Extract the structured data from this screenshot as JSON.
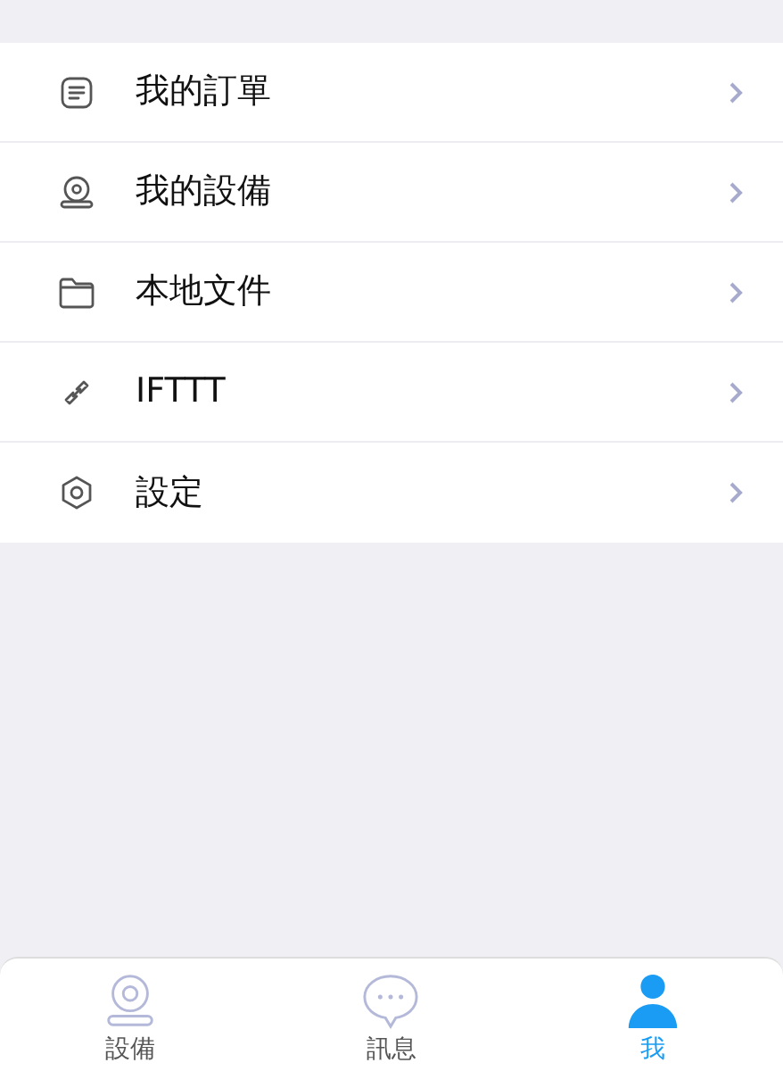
{
  "menu": [
    {
      "kind": "orders",
      "label": "我的訂單"
    },
    {
      "kind": "devices",
      "label": "我的設備"
    },
    {
      "kind": "files",
      "label": "本地文件"
    },
    {
      "kind": "link",
      "label": "IFTTT"
    },
    {
      "kind": "settings",
      "label": "設定"
    }
  ],
  "tabs": [
    {
      "kind": "camera",
      "label": "設備",
      "selected": false
    },
    {
      "kind": "message",
      "label": "訊息",
      "selected": false
    },
    {
      "kind": "person",
      "label": "我",
      "selected": true
    }
  ]
}
